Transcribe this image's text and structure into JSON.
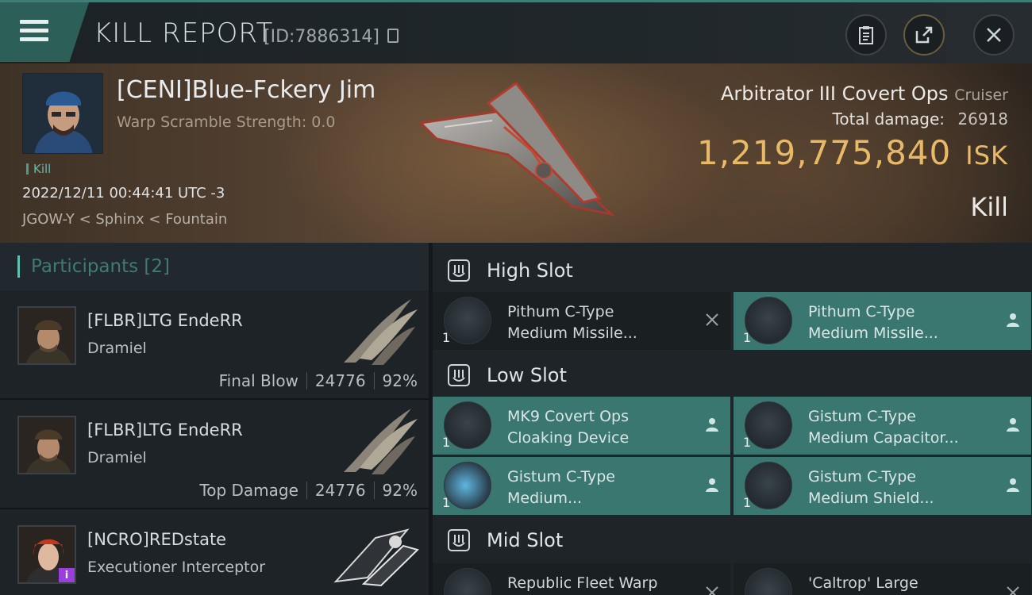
{
  "header": {
    "title": "KILL REPORT",
    "report_id": "[ID:7886314]"
  },
  "victim": {
    "name": "[CENI]Blue-Fckery Jim",
    "warp_scramble": "Warp Scramble Strength: 0.0",
    "kill_tag": "Kill",
    "datetime": "2022/12/11 00:44:41 UTC -3",
    "location": "JGOW-Y < Sphinx < Fountain",
    "ship": "Arbitrator III Covert Ops",
    "ship_class": "Cruiser",
    "total_damage_label": "Total damage:",
    "total_damage": "26918",
    "isk_value": "1,219,775,840",
    "isk_unit": "ISK",
    "result": "Kill"
  },
  "participants": {
    "label": "Participants",
    "count": "[2]",
    "items": [
      {
        "name": "[FLBR]LTG EndeRR",
        "ship": "Dramiel",
        "role": "Final Blow",
        "damage": "24776",
        "percent": "92%"
      },
      {
        "name": "[FLBR]LTG EndeRR",
        "ship": "Dramiel",
        "role": "Top Damage",
        "damage": "24776",
        "percent": "92%"
      },
      {
        "name": "[NCRO]REDstate",
        "ship": "Executioner Interceptor",
        "badge": "i"
      }
    ]
  },
  "slots": {
    "high": {
      "label": "High Slot",
      "modules": [
        {
          "count": "1",
          "line1": "Pithum C-Type",
          "line2": "Medium Missile...",
          "state": "destroyed"
        },
        {
          "count": "1",
          "line1": "Pithum C-Type",
          "line2": "Medium Missile...",
          "state": "dropped"
        }
      ]
    },
    "low": {
      "label": "Low Slot",
      "modules": [
        {
          "count": "1",
          "line1": "MK9 Covert Ops",
          "line2": "Cloaking Device",
          "state": "dropped"
        },
        {
          "count": "1",
          "line1": "Gistum C-Type",
          "line2": "Medium Capacitor...",
          "state": "dropped"
        },
        {
          "count": "1",
          "line1": "Gistum C-Type",
          "line2": "Medium...",
          "state": "dropped"
        },
        {
          "count": "1",
          "line1": "Gistum C-Type",
          "line2": "Medium Shield...",
          "state": "dropped"
        }
      ]
    },
    "mid": {
      "label": "Mid Slot",
      "modules": [
        {
          "line1": "Republic Fleet Warp",
          "state": "destroyed"
        },
        {
          "line1": "'Caltrop' Large",
          "state": "destroyed"
        }
      ]
    }
  },
  "colors": {
    "accent": "#3a7770",
    "isk": "#e8b967",
    "header_accent": "#2d5f59"
  }
}
